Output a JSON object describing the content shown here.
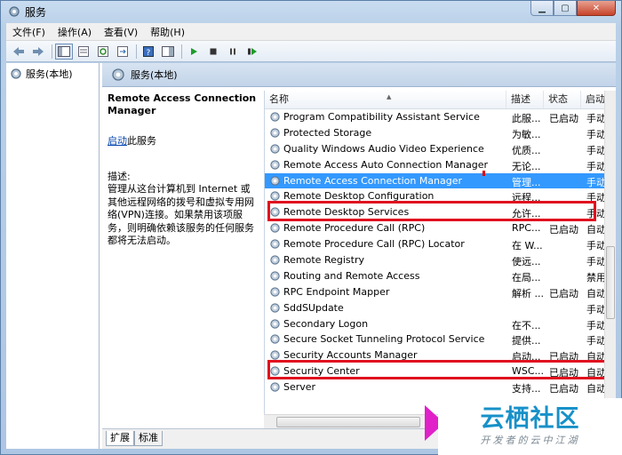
{
  "window": {
    "title": "服务"
  },
  "menu": [
    "文件(F)",
    "操作(A)",
    "查看(V)",
    "帮助(H)"
  ],
  "tree": {
    "root": "服务(本地)"
  },
  "pane": {
    "header": "服务(本地)"
  },
  "description": {
    "service_name": "Remote Access Connection Manager",
    "start_link": "启动",
    "start_suffix": "此服务",
    "label": "描述:",
    "text": "管理从这台计算机到 Internet 或其他远程网络的拨号和虚拟专用网络(VPN)连接。如果禁用该项服务，则明确依赖该服务的任何服务都将无法启动。"
  },
  "columns": {
    "name": "名称",
    "desc": "描述",
    "status": "状态",
    "startup": "启动"
  },
  "services": [
    {
      "name": "Program Compatibility Assistant Service",
      "desc": "此服...",
      "status": "已启动",
      "startup": "手动"
    },
    {
      "name": "Protected Storage",
      "desc": "为敏...",
      "status": "",
      "startup": "手动"
    },
    {
      "name": "Quality Windows Audio Video Experience",
      "desc": "优质...",
      "status": "",
      "startup": "手动"
    },
    {
      "name": "Remote Access Auto Connection Manager",
      "desc": "无论...",
      "status": "",
      "startup": "手动"
    },
    {
      "name": "Remote Access Connection Manager",
      "desc": "管理...",
      "status": "",
      "startup": "手动",
      "selected": true
    },
    {
      "name": "Remote Desktop Configuration",
      "desc": "远程...",
      "status": "",
      "startup": "手动"
    },
    {
      "name": "Remote Desktop Services",
      "desc": "允许...",
      "status": "",
      "startup": "手动"
    },
    {
      "name": "Remote Procedure Call (RPC)",
      "desc": "RPC...",
      "status": "已启动",
      "startup": "自动"
    },
    {
      "name": "Remote Procedure Call (RPC) Locator",
      "desc": "在 W...",
      "status": "",
      "startup": "手动"
    },
    {
      "name": "Remote Registry",
      "desc": "使远...",
      "status": "",
      "startup": "手动"
    },
    {
      "name": "Routing and Remote Access",
      "desc": "在局...",
      "status": "",
      "startup": "禁用"
    },
    {
      "name": "RPC Endpoint Mapper",
      "desc": "解析 ...",
      "status": "已启动",
      "startup": "自动"
    },
    {
      "name": "SddSUpdate",
      "desc": "",
      "status": "",
      "startup": "手动"
    },
    {
      "name": "Secondary Logon",
      "desc": "在不...",
      "status": "",
      "startup": "手动"
    },
    {
      "name": "Secure Socket Tunneling Protocol Service",
      "desc": "提供...",
      "status": "",
      "startup": "手动"
    },
    {
      "name": "Security Accounts Manager",
      "desc": "启动...",
      "status": "已启动",
      "startup": "自动"
    },
    {
      "name": "Security Center",
      "desc": "WSC...",
      "status": "已启动",
      "startup": "自动"
    },
    {
      "name": "Server",
      "desc": "支持...",
      "status": "已启动",
      "startup": "自动"
    }
  ],
  "tabs": [
    "扩展",
    "标准"
  ],
  "watermark": {
    "logo": "云栖社区",
    "sub": "开发者的云中江湖"
  },
  "colors": {
    "selection": "#3399ff",
    "highlight_box": "#e0101f",
    "link": "#0645ad"
  }
}
